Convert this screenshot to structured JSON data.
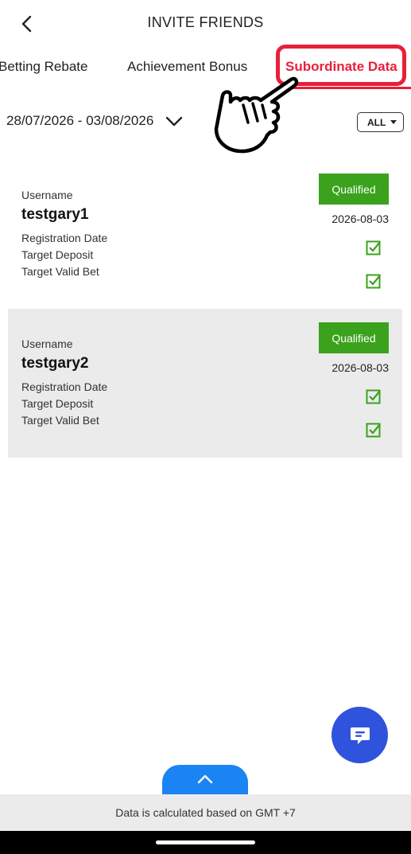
{
  "header": {
    "title": "INVITE FRIENDS",
    "back_icon": "chevron-left-icon"
  },
  "tabs": [
    {
      "label": "Betting Rebate",
      "active": false
    },
    {
      "label": "Achievement Bonus",
      "active": false
    },
    {
      "label": "Subordinate Data",
      "active": true
    }
  ],
  "filter": {
    "date_range": "28/07/2026 - 03/08/2026",
    "date_icon": "chevron-down-icon",
    "status_select": "ALL"
  },
  "cards": [
    {
      "username_label": "Username",
      "username": "testgary1",
      "status": "Qualified",
      "registration_label": "Registration Date",
      "registration_date": "2026-08-03",
      "deposit_label": "Target Deposit",
      "bet_label": "Target Valid Bet",
      "deposit_done": true,
      "bet_done": true
    },
    {
      "username_label": "Username",
      "username": "testgary2",
      "status": "Qualified",
      "registration_label": "Registration Date",
      "registration_date": "2026-08-03",
      "deposit_label": "Target Deposit",
      "bet_label": "Target Valid Bet",
      "deposit_done": true,
      "bet_done": true
    }
  ],
  "footer": {
    "note": "Data is calculated based on GMT +7"
  },
  "colors": {
    "accent_red": "#e8203a",
    "qualified_green": "#3aa21c",
    "chat_blue": "#2f53dc",
    "scroll_blue": "#1a84f4"
  },
  "icons": {
    "chat": "chat-bubble-icon",
    "scroll_top": "chevron-up-icon",
    "check": "checkbox-checked-icon",
    "pointer": "pointing-hand-icon"
  }
}
